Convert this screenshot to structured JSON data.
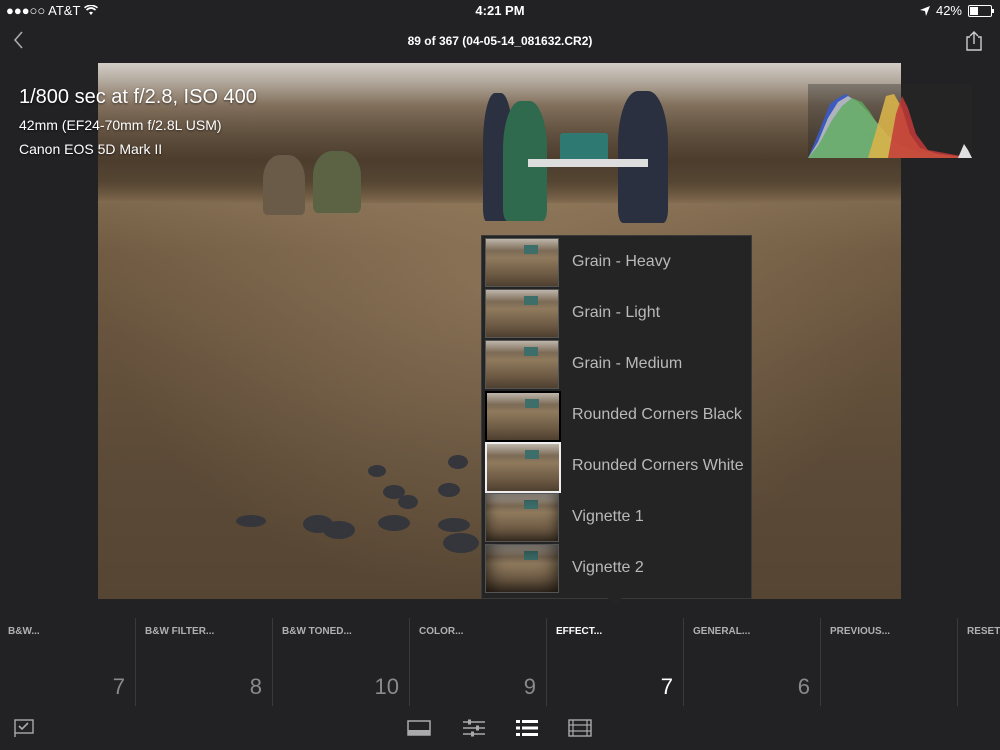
{
  "status_bar": {
    "carrier": "●●●○○ AT&T",
    "time": "4:21 PM",
    "battery": "42%"
  },
  "nav": {
    "title": "89 of 367 (04-05-14_081632.CR2)"
  },
  "exif": {
    "line1": "1/800 sec at f/2.8, ISO 400",
    "line2": "42mm (EF24-70mm f/2.8L USM)",
    "line3": "Canon EOS 5D Mark II"
  },
  "presets": [
    {
      "name": "Grain - Heavy"
    },
    {
      "name": "Grain - Light"
    },
    {
      "name": "Grain - Medium"
    },
    {
      "name": "Rounded Corners Black"
    },
    {
      "name": "Rounded Corners White"
    },
    {
      "name": "Vignette 1"
    },
    {
      "name": "Vignette 2"
    }
  ],
  "categories": [
    {
      "label": "B&W...",
      "count": "7"
    },
    {
      "label": "B&W FILTER...",
      "count": "8"
    },
    {
      "label": "B&W TONED...",
      "count": "10"
    },
    {
      "label": "COLOR...",
      "count": "9"
    },
    {
      "label": "EFFECT...",
      "count": "7",
      "active": true
    },
    {
      "label": "GENERAL...",
      "count": "6"
    },
    {
      "label": "PREVIOUS...",
      "count": ""
    },
    {
      "label": "RESET...",
      "count": ""
    }
  ],
  "colors": {
    "background": "#222224",
    "active_text": "#ffffff",
    "inactive_text": "#b0b0b0"
  },
  "toolbar": {
    "icons": [
      "flag-icon",
      "crop-icon",
      "adjust-sliders-icon",
      "presets-list-icon",
      "filmstrip-grid-icon"
    ]
  }
}
